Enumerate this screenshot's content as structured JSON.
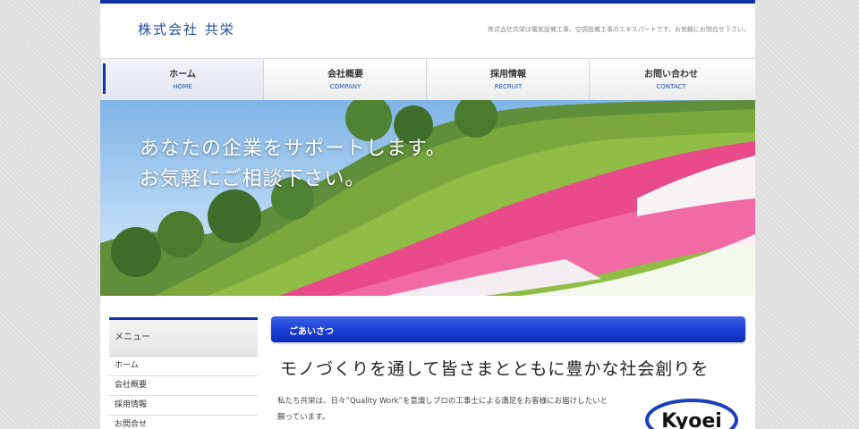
{
  "header": {
    "logo": "株式会社 共栄",
    "tagline": "株式会社共栄は電気設備工事、空調設備工事のエキスパートです。お気軽にお問合せ下さい。"
  },
  "nav": [
    {
      "label": "ホーム",
      "sub": "HOME"
    },
    {
      "label": "会社概要",
      "sub": "COMPANY"
    },
    {
      "label": "採用情報",
      "sub": "RECRUIT"
    },
    {
      "label": "お問い合わせ",
      "sub": "CONTACT"
    }
  ],
  "hero": {
    "line1": "あなたの企業をサポートします。",
    "line2": "お気軽にご相談下さい。"
  },
  "sidebar": {
    "title": "メニュー",
    "items": [
      "ホーム",
      "会社概要",
      "採用情報",
      "お問合せ"
    ]
  },
  "main": {
    "section_title": "ごあいさつ",
    "heading": "モノづくりを通して皆さまとともに豊かな社会創りを",
    "body_line1": "私たち共栄は、日々”Quality Work”を意識しプロの工事士による満足をお客様にお届けしたいと",
    "body_line2": "願っています。",
    "logo_text": "Kyoei"
  },
  "colors": {
    "accent": "#1133aa",
    "section_bar": "#1a3fd6",
    "nav_sub": "#1f4fa8"
  }
}
